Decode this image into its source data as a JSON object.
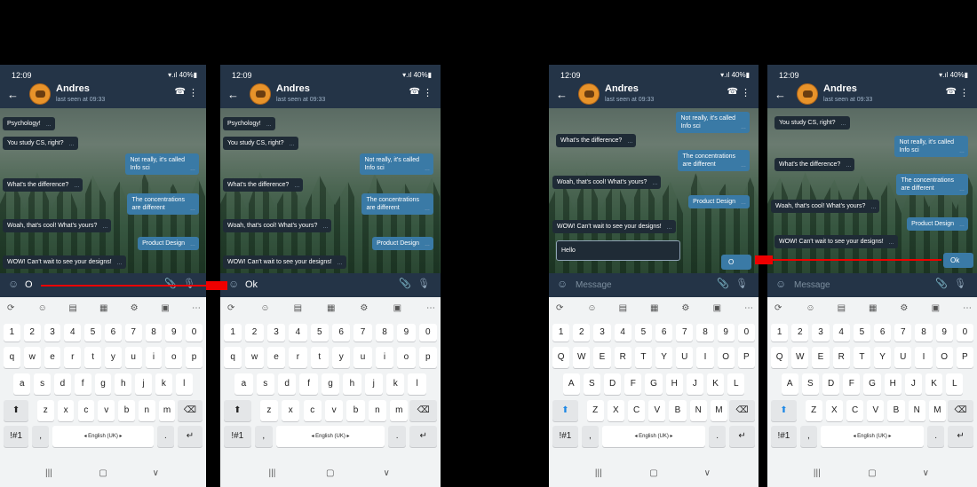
{
  "status": {
    "time": "12:09",
    "system": "▾.ıl 40%▮"
  },
  "contact": {
    "name": "Andres",
    "last_seen": "last seen at 09:33"
  },
  "icons": {
    "back": "←",
    "call": "☎",
    "more": "⋮",
    "emoji": "☺",
    "attach": "📎",
    "mic": "🎙"
  },
  "messages": {
    "psychology": "Psychology!",
    "cs": "You study CS, right?",
    "not_really_1": "Not really, it's called",
    "not_really_2": "Info sci",
    "difference": "What's the difference?",
    "conc_1": "The concentrations",
    "conc_2": "are different",
    "woah": "Woah, that's cool! What's yours?",
    "product": "Product Design",
    "wow": "WOW! Can't wait to see your designs!",
    "hello": "Hello",
    "tick": "…"
  },
  "input": {
    "screen1_text": "O",
    "screen2_text": "Ok",
    "placeholder": "Message",
    "screen3_sent": "O",
    "screen4_sent": "Ok"
  },
  "keyboard": {
    "toolbar": [
      "⟳",
      "☺",
      "▤",
      "▦",
      "⚙",
      "▣",
      "⋯"
    ],
    "numbers": [
      "1",
      "2",
      "3",
      "4",
      "5",
      "6",
      "7",
      "8",
      "9",
      "0"
    ],
    "row1_lower": [
      "q",
      "w",
      "e",
      "r",
      "t",
      "y",
      "u",
      "i",
      "o",
      "p"
    ],
    "row2_lower": [
      "a",
      "s",
      "d",
      "f",
      "g",
      "h",
      "j",
      "k",
      "l"
    ],
    "row3_lower": [
      "z",
      "x",
      "c",
      "v",
      "b",
      "n",
      "m"
    ],
    "row1_upper": [
      "Q",
      "W",
      "E",
      "R",
      "T",
      "Y",
      "U",
      "I",
      "O",
      "P"
    ],
    "row2_upper": [
      "A",
      "S",
      "D",
      "F",
      "G",
      "H",
      "J",
      "K",
      "L"
    ],
    "row3_upper": [
      "Z",
      "X",
      "C",
      "V",
      "B",
      "N",
      "M"
    ],
    "shift": "⬆",
    "backspace": "⌫",
    "symbols": "!#1",
    "comma": ",",
    "period": ".",
    "space": "◂  English (UK)  ▸",
    "enter": "↵"
  },
  "navbar": {
    "recents": "|||",
    "home": "▢",
    "back": "∨"
  },
  "colors": {
    "header": "#243447",
    "incoming": "#1f2b36",
    "outgoing": "#3a7aa6",
    "arrow": "#ee0000",
    "keyboard": "#f1f3f4"
  }
}
